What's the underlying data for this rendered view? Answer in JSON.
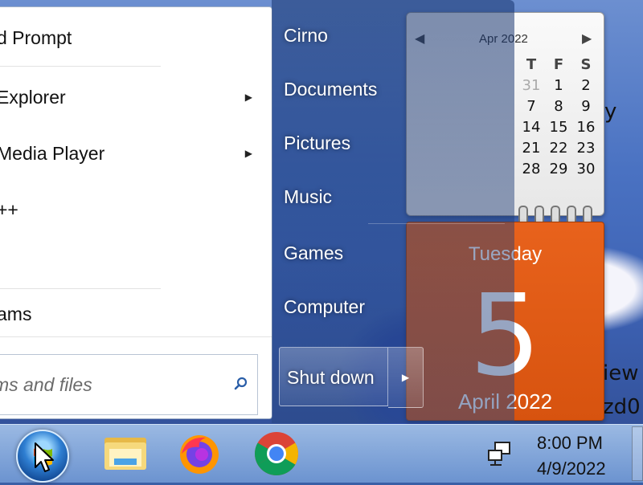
{
  "start_menu": {
    "programs": [
      {
        "label": "d Prompt",
        "has_submenu": false
      },
      {
        "label": "Explorer",
        "has_submenu": true
      },
      {
        "label": " Media Player",
        "has_submenu": true
      },
      {
        "label": "++",
        "has_submenu": false
      }
    ],
    "all_programs_label": "ams",
    "search_placeholder": "ms and files",
    "right_items": {
      "user": "Cirno",
      "documents": "Documents",
      "pictures": "Pictures",
      "music": "Music",
      "games": "Games",
      "computer": "Computer"
    },
    "shutdown_label": "Shut down"
  },
  "calendar": {
    "month_label": "Apr 2022",
    "weekday_headers": [
      "T",
      "F",
      "S"
    ],
    "rows": [
      [
        "31",
        "1",
        "2"
      ],
      [
        "7",
        "8",
        "9"
      ],
      [
        "14",
        "15",
        "16"
      ],
      [
        "21",
        "22",
        "23"
      ],
      [
        "28",
        "29",
        "30"
      ]
    ],
    "day_name": "Tuesday",
    "day_number": "5",
    "month_year": "April 2022",
    "accent_color": "#e0601a"
  },
  "desktop": {
    "text_right": "y",
    "text_iew": "iew",
    "text_zd0": "zd0"
  },
  "taskbar": {
    "pinned_icons": [
      "windows-explorer-icon",
      "firefox-icon",
      "chrome-icon"
    ],
    "clock_time": "8:00 PM",
    "clock_date": "4/9/2022"
  }
}
